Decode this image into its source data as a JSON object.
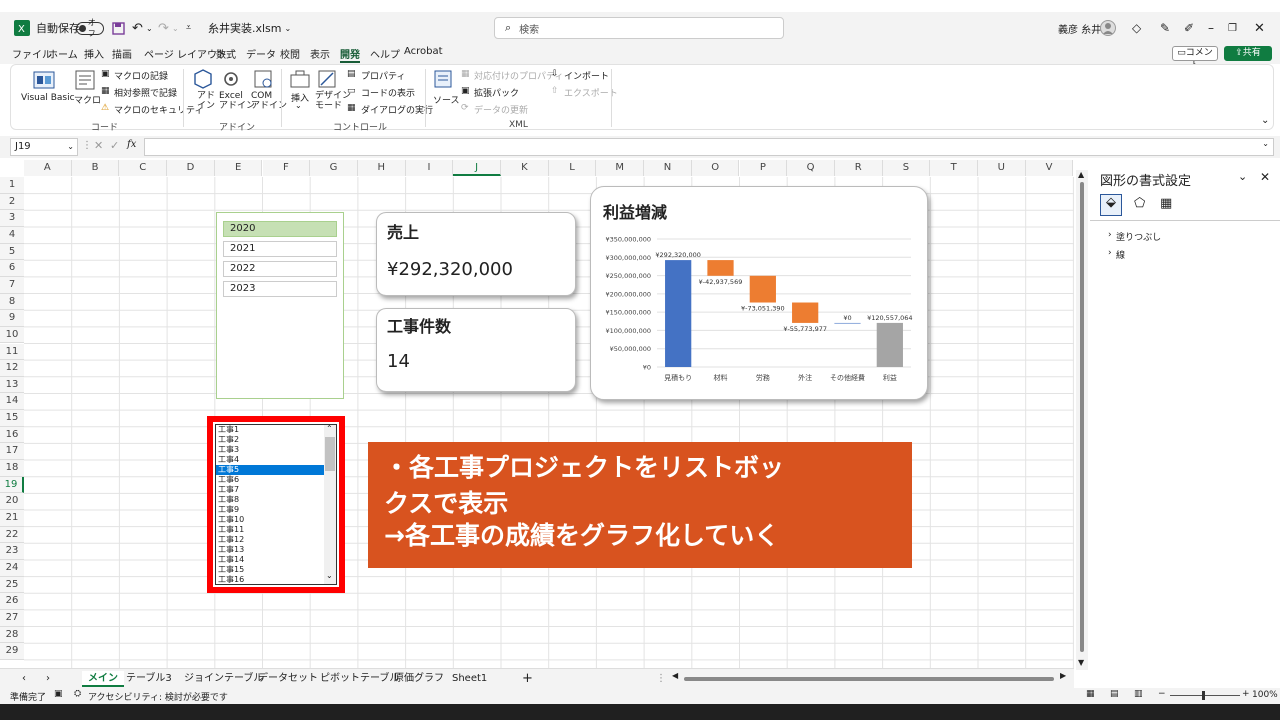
{
  "titlebar": {
    "autosave_label": "自動保存",
    "autosave_state": "オフ",
    "filename": "糸井実装.xlsm",
    "search_placeholder": "検索",
    "user_name": "義彦 糸井"
  },
  "menu": [
    "ファイル",
    "ホーム",
    "挿入",
    "描画",
    "ページ レイアウト",
    "数式",
    "データ",
    "校閲",
    "表示",
    "開発",
    "ヘルプ",
    "Acrobat"
  ],
  "menu_active": "開発",
  "menu_right": {
    "comment": "コメント",
    "share": "共有"
  },
  "ribbon": {
    "vba": "Visual Basic",
    "macro": "マクロ",
    "record": "マクロの記録",
    "relative": "相対参照で記録",
    "security": "マクロのセキュリティ",
    "group_code": "コード",
    "addin": "アド\nイン",
    "excel_addin": "Excel\nアドイン",
    "com_addin": "COM\nアドイン",
    "group_addin": "アドイン",
    "insert": "挿入",
    "design": "デザイン\nモード",
    "property": "プロパティ",
    "code_view": "コードの表示",
    "dialog": "ダイアログの実行",
    "group_control": "コントロール",
    "source": "ソース",
    "map_prop": "対応付けのプロパティ",
    "ext_pack": "拡張パック",
    "refresh": "データの更新",
    "import": "インポート",
    "export": "エクスポート",
    "group_xml": "XML"
  },
  "namebox": "J19",
  "fx": "fx",
  "columns": [
    "A",
    "B",
    "C",
    "D",
    "E",
    "F",
    "G",
    "H",
    "I",
    "J",
    "K",
    "L",
    "M",
    "N",
    "O",
    "P",
    "Q",
    "R",
    "S",
    "T",
    "U",
    "V"
  ],
  "rows": [
    "1",
    "2",
    "3",
    "4",
    "5",
    "6",
    "7",
    "8",
    "9",
    "10",
    "11",
    "12",
    "13",
    "14",
    "15",
    "16",
    "17",
    "18",
    "19",
    "20",
    "21",
    "22",
    "23",
    "24",
    "25",
    "26",
    "27",
    "28",
    "29"
  ],
  "slicer": {
    "items": [
      "2020",
      "2021",
      "2022",
      "2023"
    ],
    "selected": "2020"
  },
  "sales_card": {
    "title": "売上",
    "value": "¥292,320,000"
  },
  "count_card": {
    "title": "工事件数",
    "value": "14"
  },
  "listbox": {
    "items": [
      "工事1",
      "工事2",
      "工事3",
      "工事4",
      "工事5",
      "工事6",
      "工事7",
      "工事8",
      "工事9",
      "工事10",
      "工事11",
      "工事12",
      "工事13",
      "工事14",
      "工事15",
      "工事16"
    ],
    "selected": "工事5"
  },
  "callout": {
    "line1": "・各工事プロジェクトをリストボッ",
    "line2": "クスで表示",
    "line3": "→各工事の成績をグラフ化していく"
  },
  "chart_data": {
    "type": "bar",
    "title": "利益増減",
    "categories": [
      "見積もり",
      "材料",
      "労務",
      "外注",
      "その他経費",
      "利益"
    ],
    "values": [
      292320000,
      -42937569,
      -73051390,
      -55773977,
      0,
      120557064
    ],
    "data_labels": [
      "¥292,320,000",
      "¥-42,937,569",
      "¥-73,051,390",
      "¥-55,773,977",
      "¥0",
      "¥120,557,064"
    ],
    "yticks": [
      "¥0",
      "¥50,000,000",
      "¥100,000,000",
      "¥150,000,000",
      "¥200,000,000",
      "¥250,000,000",
      "¥300,000,000",
      "¥350,000,000"
    ],
    "ylim": [
      0,
      350000000
    ],
    "colors": {
      "total": "#4472c4",
      "decrease": "#ed7d31",
      "result": "#a5a5a5"
    }
  },
  "panel": {
    "title": "図形の書式設定",
    "fill": "塗りつぶし",
    "line": "線"
  },
  "sheet_tabs": [
    "メイン",
    "テーブル3",
    "ジョインテーブル",
    "データセット",
    "ピボットテーブル",
    "原価グラフ",
    "Sheet1"
  ],
  "active_tab": "メイン",
  "status": {
    "ready": "準備完了",
    "accessibility": "アクセシビリティ: 検討が必要です",
    "zoom": "100%"
  }
}
